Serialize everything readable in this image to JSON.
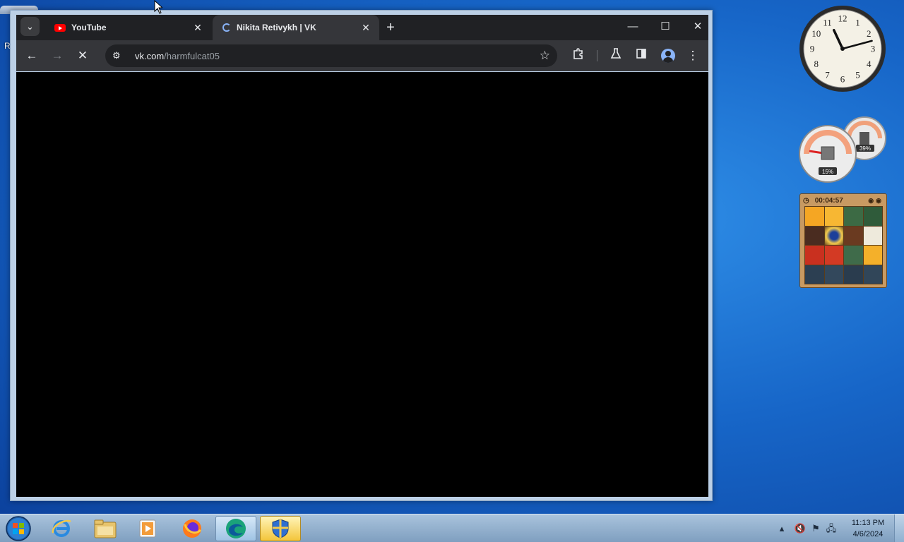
{
  "desktop": {
    "partial_icon_letter": "R"
  },
  "browser": {
    "tabs": [
      {
        "title": "YouTube",
        "favicon": "youtube-icon",
        "active": false
      },
      {
        "title": "Nikita Retivykh | VK",
        "favicon": "loading-spinner-icon",
        "active": true
      }
    ],
    "new_tab_label": "+",
    "window_controls": {
      "minimize": "—",
      "maximize": "☐",
      "close": "✕"
    },
    "toolbar": {
      "back": "←",
      "forward": "→",
      "stop": "✕",
      "url_host": "vk.com",
      "url_path": "/harmfulcat05",
      "bookmark_star": "☆",
      "menu": "⋮"
    },
    "content_color": "#000000"
  },
  "gadgets": {
    "clock": {
      "hour_hand_angle_deg": 335,
      "minute_hand_angle_deg": 75,
      "numerals": [
        "12",
        "1",
        "2",
        "3",
        "4",
        "5",
        "6",
        "7",
        "8",
        "9",
        "10",
        "11"
      ]
    },
    "cpu_meter": {
      "cpu_label": "15%",
      "memory_label": "39%"
    },
    "puzzle": {
      "timer": "00:04:57"
    }
  },
  "taskbar": {
    "apps": [
      {
        "name": "internet-explorer",
        "state": "normal"
      },
      {
        "name": "windows-explorer",
        "state": "normal"
      },
      {
        "name": "media-player",
        "state": "normal"
      },
      {
        "name": "firefox",
        "state": "normal"
      },
      {
        "name": "edge",
        "state": "active"
      },
      {
        "name": "security-shield",
        "state": "selected"
      }
    ],
    "time": "11:13 PM",
    "date": "4/6/2024"
  }
}
